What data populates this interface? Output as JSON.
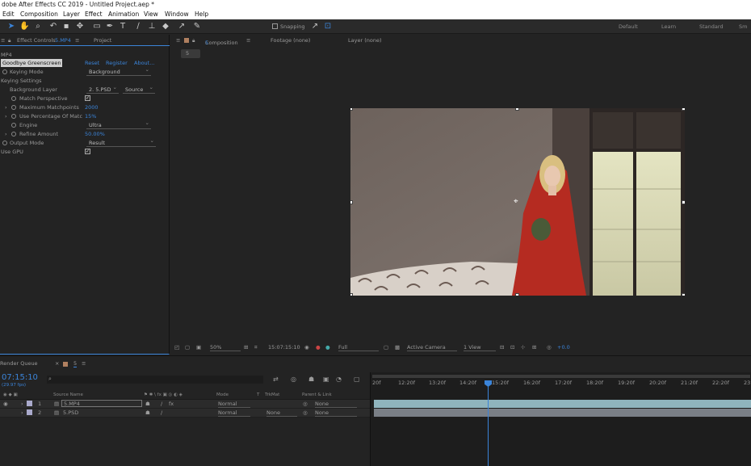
{
  "app": {
    "title": "dobe After Effects CC 2019 - Untitled Project.aep *"
  },
  "menu": [
    "Edit",
    "Composition",
    "Layer",
    "Effect",
    "Animation",
    "View",
    "Window",
    "Help"
  ],
  "toolbar": {
    "snapping_label": "Snapping",
    "workspaces": [
      "Default",
      "Learn",
      "Standard",
      "Sm"
    ]
  },
  "effect_controls": {
    "tab_label": "Effect Controls",
    "tab_file": "5.MP4",
    "tab_project": "Project",
    "source_label": "MP4",
    "effect_name": "Goodbye Greenscreen",
    "links": [
      "Reset",
      "Register",
      "About..."
    ],
    "keying_mode_label": "Keying Mode",
    "keying_mode_value": "Background",
    "keying_settings_label": "Keying Settings",
    "background_layer_label": "Background Layer",
    "background_layer_value": "2. 5.PSD",
    "background_layer_source": "Source",
    "match_perspective_label": "Match Perspective",
    "max_matchpoints_label": "Maximum Matchpoints",
    "max_matchpoints_value": "2000",
    "use_percentage_label": "Use Percentage Of Matc",
    "use_percentage_value": "15%",
    "engine_label": "Engine",
    "engine_value": "Ultra",
    "refine_amount_label": "Refine Amount",
    "refine_amount_value": "50.00%",
    "output_mode_label": "Output Mode",
    "output_mode_value": "Result",
    "use_gpu_label": "Use GPU"
  },
  "viewer": {
    "comp_tab": "Composition",
    "comp_tab_name": "5",
    "footage_tab": "Footage  (none)",
    "layer_tab": "Layer  (none)",
    "breadcrumb": "5",
    "zoom": "50%",
    "timecode": "15:07:15:10",
    "resolution": "Full",
    "camera": "Active Camera",
    "views": "1 View",
    "exposure": "+0.0"
  },
  "timeline": {
    "render_queue_tab": "Render Queue",
    "comp_tab": "5",
    "timecode": "07:15:10",
    "frame_info": "(29.97 fps)",
    "search_icon": "search-icon",
    "columns": [
      "Source Name",
      "Mode",
      "T",
      "TrkMat",
      "Parent & Link"
    ],
    "layers": [
      {
        "num": "1",
        "name": "5.MP4",
        "mode": "Normal",
        "trkmat": "",
        "parent": "None"
      },
      {
        "num": "2",
        "name": "5.PSD",
        "mode": "Normal",
        "trkmat": "None",
        "parent": "None"
      }
    ],
    "ruler": [
      "20f",
      "12:20f",
      "13:20f",
      "14:20f",
      "15:20f",
      "16:20f",
      "17:20f",
      "18:20f",
      "19:20f",
      "20:20f",
      "21:20f",
      "22:20f",
      "23"
    ]
  },
  "colors": {
    "accent": "#3b84d9",
    "panel": "#232323",
    "track": "#8fb4bd"
  }
}
